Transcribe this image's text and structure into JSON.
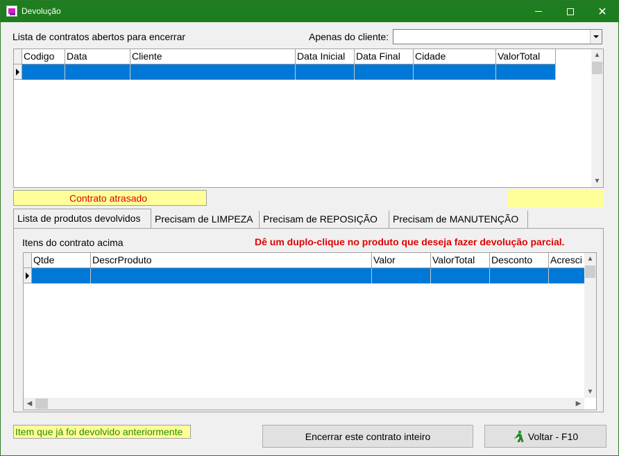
{
  "window": {
    "title": "Devolução"
  },
  "top": {
    "section_label": "Lista de contratos abertos para encerrar",
    "client_filter_label": "Apenas do cliente:",
    "client_filter_value": "",
    "columns": [
      "Codigo",
      "Data",
      "Cliente",
      "Data Inicial",
      "Data Final",
      "Cidade",
      "ValorTotal"
    ],
    "legend_late": "Contrato atrasado"
  },
  "tabs": [
    {
      "label": "Lista de produtos devolvidos",
      "active": true
    },
    {
      "label": "Precisam de LIMPEZA",
      "active": false
    },
    {
      "label": "Precisam de REPOSIÇÃO",
      "active": false
    },
    {
      "label": "Precisam de MANUTENÇÃO",
      "active": false
    }
  ],
  "items": {
    "section_label": "Itens do contrato acima",
    "hint": "Dê um duplo-clique no produto que deseja fazer devolução parcial.",
    "columns": [
      "Qtde",
      "DescrProduto",
      "Valor",
      "ValorTotal",
      "Desconto",
      "Acresci"
    ]
  },
  "footer": {
    "legend_returned": "Item que já foi devolvido anteriormente",
    "close_button": "Encerrar este contrato inteiro",
    "back_button": "Voltar - F10"
  },
  "colors": {
    "titlebar": "#1e7d1e",
    "selection": "#0078d7",
    "legend_yellow": "#ffff99",
    "alert_red": "#e00000",
    "returned_green": "#2a8a00"
  }
}
